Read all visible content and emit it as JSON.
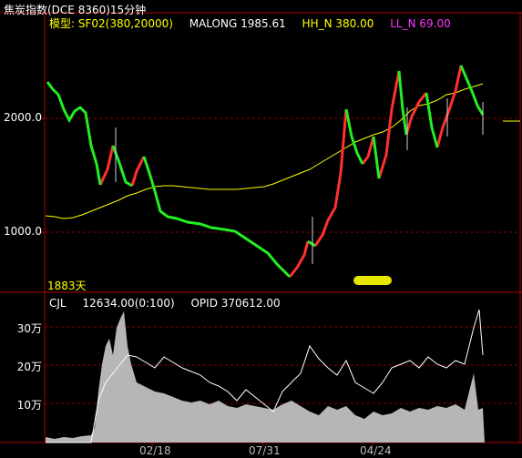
{
  "header": {
    "title": "焦炭指数(DCE 8360)15分钟"
  },
  "legend": {
    "model": "模型: SF02(380,20000)",
    "malong": "MALONG 1985.61",
    "hh_n": "HH_N 380.00",
    "ll_n": "LL_N 69.00"
  },
  "price_axis": {
    "label_2000": "2000.0",
    "label_1000": "1000.0"
  },
  "days_label": "1883天",
  "volume_legend": {
    "cjl": "CJL",
    "cjl_value": "12634.00(0:100)",
    "opid": "OPID 370612.00"
  },
  "volume_axis": {
    "label_30": "30万",
    "label_20": "20万",
    "label_10": "10万"
  },
  "date_axis": {
    "d1": "02/18",
    "d2": "07/31",
    "d3": "04/24"
  },
  "colors": {
    "up": "#ff3030",
    "down": "#00dd00",
    "malong": "#ffff00",
    "grid": "#8b0000",
    "axis": "#b00000",
    "volume": "#c0c0c0"
  }
}
